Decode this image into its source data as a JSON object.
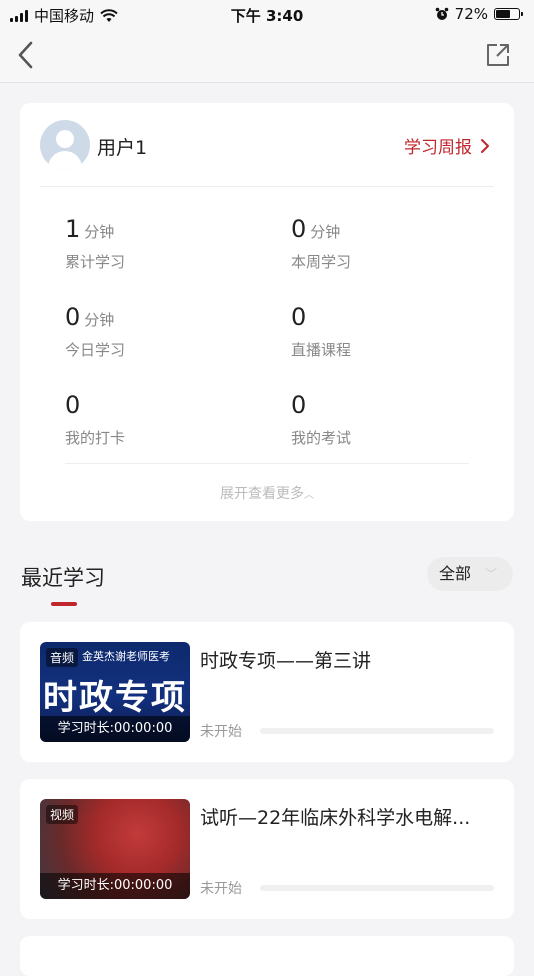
{
  "status_bar": {
    "carrier": "中国移动",
    "time": "下午 3:40",
    "battery": "72%",
    "battery_level": 0.72
  },
  "nav": {
    "back_icon": "chevron-left-icon",
    "share_icon": "share-external-icon"
  },
  "profile": {
    "name": "用户1",
    "weekly_report": "学习周报",
    "stats": [
      {
        "value": "1",
        "unit": "分钟",
        "label": "累计学习"
      },
      {
        "value": "0",
        "unit": "分钟",
        "label": "本周学习"
      },
      {
        "value": "0",
        "unit": "分钟",
        "label": "今日学习"
      },
      {
        "value": "0",
        "unit": "",
        "label": "直播课程"
      },
      {
        "value": "0",
        "unit": "",
        "label": "我的打卡"
      },
      {
        "value": "0",
        "unit": "",
        "label": "我的考试"
      }
    ],
    "expand_label": "展开查看更多"
  },
  "recent": {
    "title": "最近学习",
    "filter": "全部"
  },
  "courses": [
    {
      "type_badge": "音频",
      "thumb_brand": "金英杰谢老师医考",
      "thumb_title": "时政专项",
      "duration": "学习时长:00:00:00",
      "title": "时政专项——第三讲",
      "status": "未开始",
      "progress": 0
    },
    {
      "type_badge": "视频",
      "duration": "学习时长:00:00:00",
      "title": "试听—22年临床外科学水电解...",
      "status": "未开始",
      "progress": 0
    }
  ],
  "colors": {
    "accent": "#c0262d",
    "background": "#f4f4f6"
  }
}
